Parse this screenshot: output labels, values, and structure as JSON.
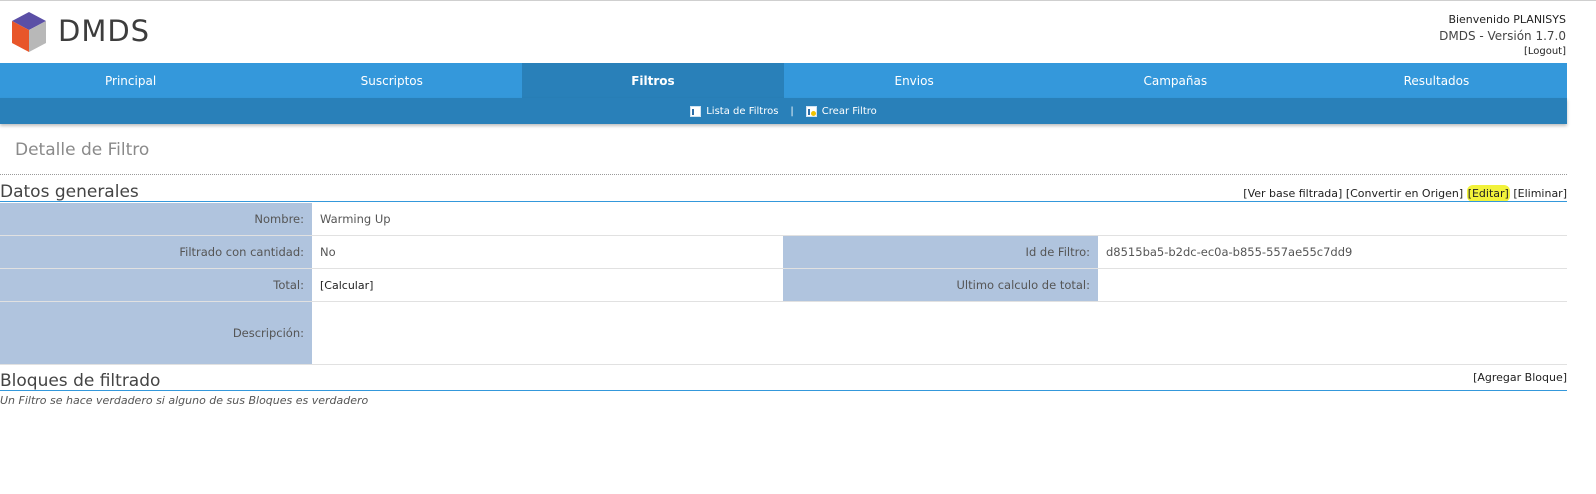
{
  "header": {
    "logo_text": "DMDS",
    "welcome": "Bienvenido PLANISYS",
    "version": "DMDS - Versión 1.7.0",
    "logout": "[Logout]"
  },
  "nav": {
    "items": [
      "Principal",
      "Suscriptos",
      "Filtros",
      "Envios",
      "Campañas",
      "Resultados"
    ],
    "active": "Filtros"
  },
  "subnav": {
    "list_label": "Lista de Filtros",
    "separator": "|",
    "create_label": "Crear Filtro"
  },
  "page": {
    "title": "Detalle de Filtro"
  },
  "general": {
    "title": "Datos generales",
    "actions": {
      "view_base": "[Ver base filtrada]",
      "convert": "[Convertir en Origen]",
      "edit": "[Editar]",
      "delete": "[Eliminar]"
    },
    "fields": {
      "name_label": "Nombre:",
      "name_value": "Warming Up",
      "qty_label": "Filtrado con cantidad:",
      "qty_value": "No",
      "id_label": "Id de Filtro:",
      "id_value": "d8515ba5-b2dc-ec0a-b855-557ae55c7dd9",
      "total_label": "Total:",
      "total_value": "[Calcular]",
      "last_calc_label": "Ultimo calculo de total:",
      "last_calc_value": "",
      "desc_label": "Descripción:",
      "desc_value": ""
    }
  },
  "blocks": {
    "title": "Bloques de filtrado",
    "add": "[Agregar Bloque]",
    "note": "Un Filtro se hace verdadero si alguno de sus Bloques es verdadero"
  },
  "colors": {
    "nav": "#3498db",
    "nav_active": "#2980b9",
    "label_cell": "#b0c4de",
    "highlight": "#f2f23a"
  }
}
